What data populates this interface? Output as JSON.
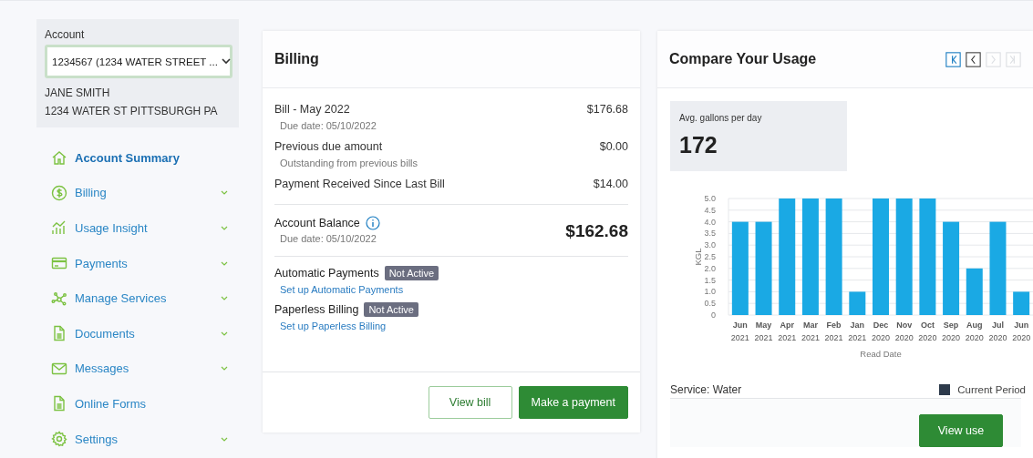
{
  "sidebar": {
    "account": {
      "label": "Account",
      "selector_value": "1234567 (1234 WATER STREET ...",
      "name": "JANE SMITH",
      "address": "1234 WATER ST PITTSBURGH PA"
    },
    "items": [
      {
        "kind": "home",
        "label": "Account Summary",
        "selected": true,
        "expandable": false
      },
      {
        "kind": "dollar",
        "label": "Billing",
        "selected": false,
        "expandable": true
      },
      {
        "kind": "chart",
        "label": "Usage Insight",
        "selected": false,
        "expandable": true
      },
      {
        "kind": "card",
        "label": "Payments",
        "selected": false,
        "expandable": true
      },
      {
        "kind": "network",
        "label": "Manage Services",
        "selected": false,
        "expandable": true
      },
      {
        "kind": "document",
        "label": "Documents",
        "selected": false,
        "expandable": true
      },
      {
        "kind": "mail",
        "label": "Messages",
        "selected": false,
        "expandable": true
      },
      {
        "kind": "document",
        "label": "Online Forms",
        "selected": false,
        "expandable": false
      },
      {
        "kind": "gear",
        "label": "Settings",
        "selected": false,
        "expandable": true
      }
    ]
  },
  "billing": {
    "title": "Billing",
    "lines": [
      {
        "label": "Bill - May 2022",
        "note": "Due date: 05/10/2022",
        "amount": "$176.68"
      },
      {
        "label": "Previous due amount",
        "note": "Outstanding from previous bills",
        "amount": "$0.00"
      },
      {
        "label": "Payment Received Since Last Bill",
        "amount": "$14.00"
      }
    ],
    "balance": {
      "label": "Account Balance",
      "note": "Due date: 05/10/2022",
      "amount": "$162.68"
    },
    "programs": [
      {
        "label": "Automatic Payments",
        "status": "Not Active",
        "active": false,
        "link": "Set up Automatic Payments"
      },
      {
        "label": "Paperless Billing",
        "status": "Not Active",
        "active": false,
        "link": "Set up Paperless Billing"
      }
    ],
    "buttons": [
      {
        "kind": "secondary",
        "label": "View bill"
      },
      {
        "kind": "primary",
        "label": "Make a payment"
      }
    ]
  },
  "usage": {
    "title": "Compare Your Usage",
    "pager": [
      {
        "kind": "first",
        "selected": true,
        "disabled": false
      },
      {
        "kind": "prev",
        "selected": false,
        "disabled": false
      },
      {
        "kind": "next",
        "selected": false,
        "disabled": true
      },
      {
        "kind": "last",
        "selected": false,
        "disabled": true
      }
    ],
    "average": {
      "label": "Avg. gallons per day",
      "value": "172"
    },
    "chart_data": {
      "type": "bar",
      "xlabel": "Read Date",
      "ylabel": "KGL",
      "categories": [
        "Jun 2021",
        "May 2021",
        "Apr 2021",
        "Mar 2021",
        "Feb 2021",
        "Jan 2021",
        "Dec 2020",
        "Nov 2020",
        "Oct 2020",
        "Sep 2020",
        "Aug 2020",
        "Jul 2020",
        "Jun 2020"
      ],
      "series": [
        {
          "color": "#1aa9e4",
          "values": [
            4,
            4,
            5,
            5,
            5,
            1,
            5,
            5,
            5,
            4,
            2,
            4,
            1
          ]
        }
      ],
      "grid": true,
      "ylim": [
        0,
        5
      ],
      "yticks": [
        {
          "value": 0,
          "label": "0"
        },
        {
          "value": 0.5,
          "label": "0.5"
        },
        {
          "value": 1,
          "label": "1.0"
        },
        {
          "value": 1.5,
          "label": "1.5"
        },
        {
          "value": 2,
          "label": "2.0"
        },
        {
          "value": 2.5,
          "label": "2.5"
        },
        {
          "value": 3,
          "label": "3.0"
        },
        {
          "value": 3.5,
          "label": "3.5"
        },
        {
          "value": 4,
          "label": "4.0"
        },
        {
          "value": 4.5,
          "label": "4.5"
        },
        {
          "value": 5,
          "label": "5.0"
        }
      ]
    },
    "service": "Service: Water",
    "legend": {
      "label": "Current Period",
      "color": "#2d3a4b"
    },
    "button": "View use"
  }
}
